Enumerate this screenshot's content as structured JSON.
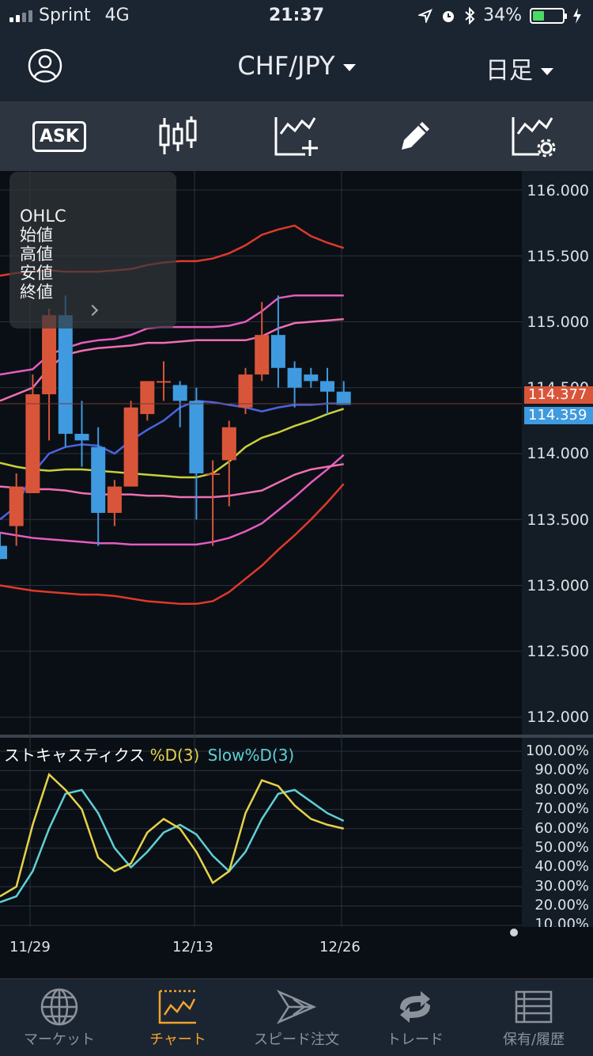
{
  "status": {
    "carrier": "Sprint",
    "network": "4G",
    "time": "21:37",
    "battery": "34%"
  },
  "header": {
    "pair": "CHF/JPY",
    "period": "日足"
  },
  "toolbar": {
    "ask_label": "ASK"
  },
  "ohlc_panel": {
    "lines": [
      "OHLC",
      "始値",
      "高値",
      "安値",
      "終値"
    ]
  },
  "price_axis": {
    "labels": [
      "116.000",
      "115.500",
      "115.000",
      "114.500",
      "114.000",
      "113.500",
      "113.000",
      "112.500",
      "112.000"
    ]
  },
  "price_tags": {
    "ask": "114.377",
    "bid": "114.359"
  },
  "stoch": {
    "title": "ストキャスティクス",
    "d_label": "%D(3)",
    "slow_label": "Slow%D(3)",
    "axis": [
      "100.00%",
      "90.00%",
      "80.00%",
      "70.00%",
      "60.00%",
      "50.00%",
      "40.00%",
      "30.00%",
      "20.00%",
      "10.00%"
    ]
  },
  "dates": [
    "11/29",
    "12/13",
    "12/26"
  ],
  "tabs": [
    {
      "label": "マーケット"
    },
    {
      "label": "チャート"
    },
    {
      "label": "スピード注文"
    },
    {
      "label": "トレード"
    },
    {
      "label": "保有/履歴"
    }
  ],
  "colors": {
    "up": "#d9553a",
    "down": "#3f9ae0",
    "active_tab": "#f0a330"
  },
  "chart_data": {
    "type": "candlestick",
    "candles": [
      {
        "o": 113.3,
        "h": 113.4,
        "l": 113.2,
        "c": 113.2
      },
      {
        "o": 113.45,
        "h": 113.85,
        "l": 113.3,
        "c": 113.75
      },
      {
        "o": 113.7,
        "h": 114.6,
        "l": 113.7,
        "c": 114.45
      },
      {
        "o": 114.45,
        "h": 115.1,
        "l": 114.1,
        "c": 115.05
      },
      {
        "o": 115.05,
        "h": 115.2,
        "l": 114.05,
        "c": 114.15
      },
      {
        "o": 114.15,
        "h": 114.4,
        "l": 113.9,
        "c": 114.1
      },
      {
        "o": 114.05,
        "h": 114.2,
        "l": 113.3,
        "c": 113.55
      },
      {
        "o": 113.55,
        "h": 113.8,
        "l": 113.45,
        "c": 113.75
      },
      {
        "o": 113.75,
        "h": 114.4,
        "l": 113.75,
        "c": 114.35
      },
      {
        "o": 114.3,
        "h": 114.55,
        "l": 114.25,
        "c": 114.55
      },
      {
        "o": 114.55,
        "h": 114.7,
        "l": 114.4,
        "c": 114.55
      },
      {
        "o": 114.52,
        "h": 114.55,
        "l": 114.2,
        "c": 114.4
      },
      {
        "o": 114.4,
        "h": 114.5,
        "l": 113.5,
        "c": 113.85
      },
      {
        "o": 113.85,
        "h": 113.95,
        "l": 113.3,
        "c": 113.85
      },
      {
        "o": 113.95,
        "h": 114.25,
        "l": 113.6,
        "c": 114.2
      },
      {
        "o": 114.35,
        "h": 114.65,
        "l": 114.3,
        "c": 114.6
      },
      {
        "o": 114.6,
        "h": 115.15,
        "l": 114.55,
        "c": 114.9
      },
      {
        "o": 114.9,
        "h": 115.2,
        "l": 114.5,
        "c": 114.65
      },
      {
        "o": 114.65,
        "h": 114.7,
        "l": 114.35,
        "c": 114.5
      },
      {
        "o": 114.6,
        "h": 114.65,
        "l": 114.5,
        "c": 114.55
      },
      {
        "o": 114.55,
        "h": 114.65,
        "l": 114.3,
        "c": 114.47
      },
      {
        "o": 114.47,
        "h": 114.55,
        "l": 114.37,
        "c": 114.37
      }
    ],
    "ma": [
      113.93,
      113.9,
      113.88,
      113.87,
      113.88,
      113.88,
      113.87,
      113.86,
      113.85,
      113.84,
      113.83,
      113.82,
      113.82,
      113.85,
      113.94,
      114.05,
      114.12,
      114.16,
      114.21,
      114.25,
      114.3,
      114.34
    ],
    "mid": [
      113.5,
      113.6,
      113.85,
      114.0,
      114.05,
      114.07,
      114.06,
      114.0,
      114.1,
      114.18,
      114.25,
      114.35,
      114.4,
      114.39,
      114.37,
      114.35,
      114.32,
      114.35,
      114.37,
      114.37,
      114.38,
      114.38
    ],
    "upper1": [
      114.4,
      114.45,
      114.5,
      114.65,
      114.75,
      114.78,
      114.8,
      114.81,
      114.82,
      114.84,
      114.84,
      114.85,
      114.86,
      114.86,
      114.86,
      114.86,
      114.89,
      114.95,
      114.99,
      115.0,
      115.01,
      115.02
    ],
    "upper2": [
      114.6,
      114.62,
      114.64,
      114.75,
      114.8,
      114.84,
      114.86,
      114.87,
      114.9,
      114.95,
      114.96,
      114.96,
      114.96,
      114.96,
      114.97,
      115.0,
      115.08,
      115.18,
      115.2,
      115.2,
      115.2,
      115.2
    ],
    "upper3": [
      115.35,
      115.37,
      115.38,
      115.39,
      115.38,
      115.38,
      115.38,
      115.39,
      115.4,
      115.43,
      115.45,
      115.46,
      115.46,
      115.48,
      115.52,
      115.58,
      115.66,
      115.7,
      115.73,
      115.65,
      115.6,
      115.56
    ],
    "lower1": [
      113.75,
      113.74,
      113.73,
      113.73,
      113.72,
      113.7,
      113.69,
      113.69,
      113.69,
      113.68,
      113.68,
      113.67,
      113.67,
      113.67,
      113.68,
      113.7,
      113.72,
      113.78,
      113.84,
      113.88,
      113.9,
      113.92
    ],
    "lower2": [
      113.4,
      113.38,
      113.36,
      113.35,
      113.34,
      113.33,
      113.32,
      113.32,
      113.31,
      113.31,
      113.31,
      113.31,
      113.31,
      113.33,
      113.36,
      113.41,
      113.47,
      113.57,
      113.67,
      113.78,
      113.88,
      113.99
    ],
    "lower3": [
      113.0,
      112.98,
      112.96,
      112.95,
      112.94,
      112.93,
      112.93,
      112.92,
      112.9,
      112.88,
      112.87,
      112.86,
      112.86,
      112.88,
      112.95,
      113.05,
      113.15,
      113.27,
      113.38,
      113.5,
      113.63,
      113.77
    ],
    "stoch_d": [
      25,
      30,
      62,
      88,
      80,
      70,
      45,
      38,
      42,
      58,
      65,
      60,
      48,
      32,
      38,
      68,
      85,
      82,
      72,
      65,
      62,
      60
    ],
    "stoch_slow": [
      22,
      25,
      38,
      60,
      78,
      80,
      68,
      50,
      40,
      48,
      58,
      62,
      57,
      46,
      38,
      48,
      65,
      78,
      80,
      74,
      68,
      64
    ],
    "ylim": [
      112.0,
      116.0
    ],
    "stoch_ylim": [
      10,
      100
    ]
  }
}
